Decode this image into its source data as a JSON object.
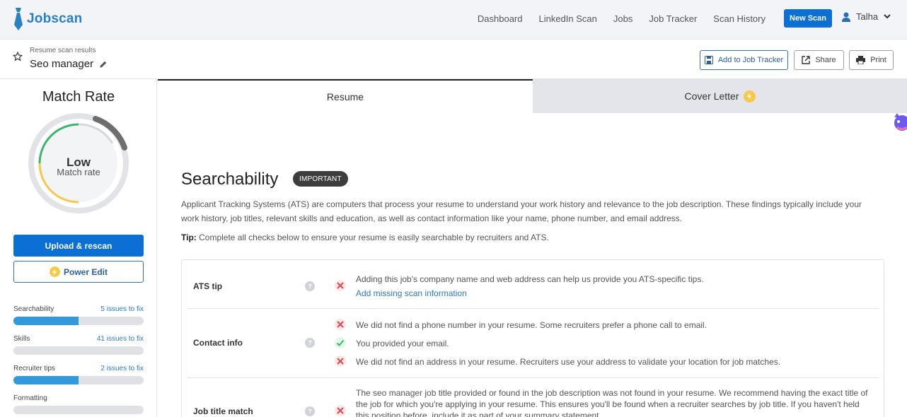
{
  "brand": {
    "name": "Jobscan",
    "color": "#2a80c4"
  },
  "nav": {
    "links": [
      "Dashboard",
      "LinkedIn Scan",
      "Jobs",
      "Job Tracker",
      "Scan History"
    ],
    "new_scan": "New Scan",
    "user": "Talha"
  },
  "subheader": {
    "kicker": "Resume scan results",
    "title": "Seo manager",
    "add_tracker": "Add to Job Tracker",
    "share": "Share",
    "print": "Print"
  },
  "sidebar": {
    "match_title": "Match Rate",
    "gauge_main": "Low",
    "gauge_sub": "Match rate",
    "upload": "Upload & rescan",
    "power_edit": "Power Edit",
    "metrics": [
      {
        "name": "Searchability",
        "fix": "5 issues to fix",
        "progress": 0.5
      },
      {
        "name": "Skills",
        "fix": "41 issues to fix",
        "progress": 0
      },
      {
        "name": "Recruiter tips",
        "fix": "2 issues to fix",
        "progress": 0.5
      },
      {
        "name": "Formatting",
        "fix": "",
        "progress": 0
      }
    ]
  },
  "tabs": {
    "resume": "Resume",
    "cover": "Cover Letter"
  },
  "section": {
    "title": "Searchability",
    "badge": "IMPORTANT",
    "description": "Applicant Tracking Systems (ATS) are computers that process your resume to understand your work history and relevance to the job description. These findings typically include your work history, job titles, relevant skills and education, as well as contact information like your name, phone number, and email address.",
    "tip_label": "Tip:",
    "tip_text": " Complete all checks below to ensure your resume is easily searchable by recruiters and ATS."
  },
  "checks": {
    "ats": {
      "label": "ATS tip",
      "text": "Adding this job's company name and web address can help us provide you ATS-specific tips.",
      "link": "Add missing scan information"
    },
    "contact": {
      "label": "Contact info",
      "items": [
        "We did not find a phone number in your resume. Some recruiters prefer a phone call to email.",
        "You provided your email.",
        "We did not find an address in your resume. Recruiters use your address to validate your location for job matches."
      ]
    },
    "job_title": {
      "label": "Job title match",
      "lines": [
        "The seo manager job title provided or found in the job description was not found in your resume. We recommend having the exact title of",
        "the job for which you're applying in your resume. This ensures you'll be found when a recruiter searches by job title. If you haven't held",
        "this position before, include it as part of your summary statement."
      ]
    }
  },
  "colors": {
    "primary": "#0b6fd4",
    "fail": "#e0474c",
    "pass": "#3bb56b",
    "bar": "#3199dc"
  }
}
